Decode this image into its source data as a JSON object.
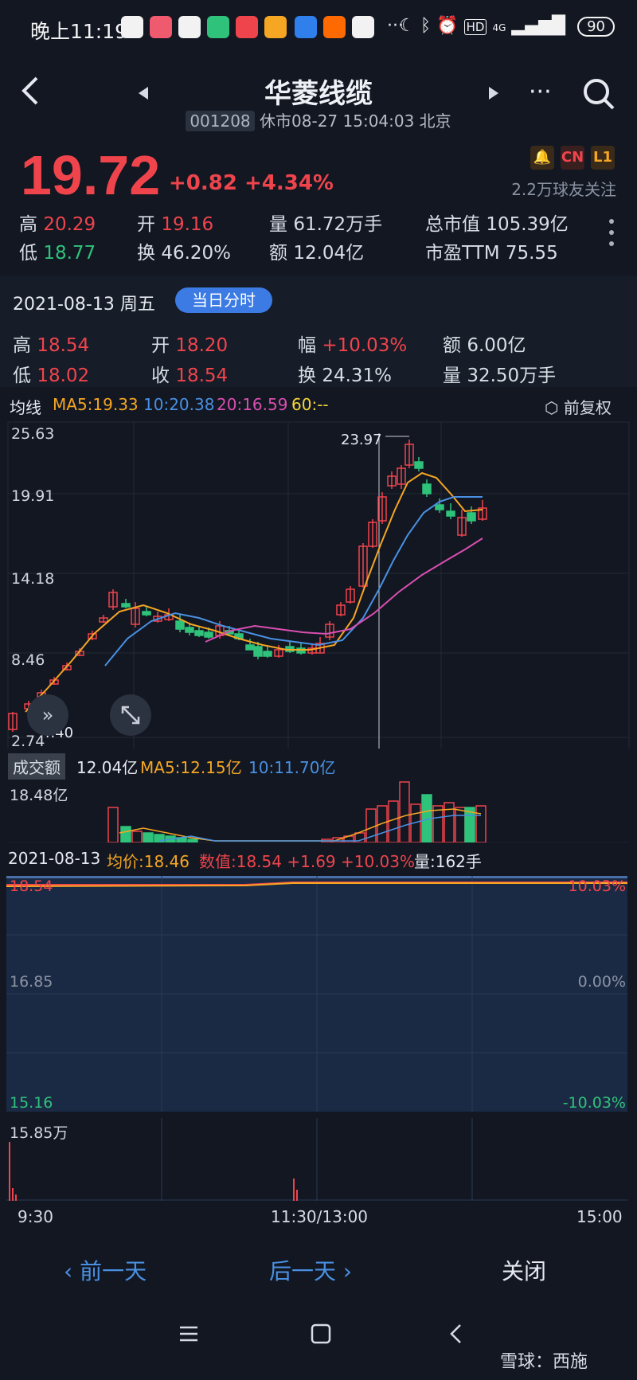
{
  "status_bar": {
    "time": "晚上11:19",
    "network": "4G",
    "hd": "HD",
    "battery": "90",
    "dots": "···"
  },
  "header": {
    "title": "华菱线缆",
    "code": "001208",
    "status": "休市08-27 15:04:03 北京",
    "more": "···"
  },
  "quote": {
    "price": "19.72",
    "change": "+0.82 +4.34%",
    "badge_cn": "CN",
    "badge_l1": "L1",
    "followers": "2.2万球友关注",
    "high_label": "高",
    "high": "20.29",
    "open_label": "开",
    "open": "19.16",
    "volume_label": "量",
    "volume": "61.72万手",
    "mktcap_label": "总市值",
    "mktcap": "105.39亿",
    "low_label": "低",
    "low": "18.77",
    "turnover_label": "换",
    "turnover": "46.20%",
    "amount_label": "额",
    "amount": "12.04亿",
    "pe_label": "市盈TTM",
    "pe": "75.55"
  },
  "day_detail": {
    "date": "2021-08-13 周五",
    "button": "当日分时",
    "high_label": "高",
    "high": "18.54",
    "open_label": "开",
    "open": "18.20",
    "range_label": "幅",
    "range": "+10.03%",
    "amount_label": "额",
    "amount": "6.00亿",
    "low_label": "低",
    "low": "18.02",
    "close_label": "收",
    "close": "18.54",
    "turnover_label": "换",
    "turnover": "24.31%",
    "volume_label": "量",
    "volume": "32.50万手"
  },
  "kline": {
    "ma_title": "均线",
    "ma5": "MA5:19.33",
    "ma10": "10:20.38",
    "ma20": "20:16.59",
    "ma60": "60:--",
    "adjust": "前复权",
    "y_labels": [
      "25.63",
      "19.91",
      "14.18",
      "8.46",
      "2.74"
    ],
    "max_label": "23.97",
    "min_label": "4.40",
    "colors": {
      "ma5": "#f5a623",
      "ma10": "#4a90e2",
      "ma20": "#d94fb0",
      "up": "#f0444c",
      "down": "#2fc27a"
    }
  },
  "volume_panel": {
    "title": "成交额",
    "amount": "12.04亿",
    "ma5": "MA5:12.15亿",
    "ma10": "10:11.70亿",
    "y_top": "18.48亿"
  },
  "intraday": {
    "date": "2021-08-13",
    "avg": "均价:18.46",
    "value": "数值:18.54 +1.69 +10.03%",
    "qty": "量:162手",
    "y_top": "18.54",
    "y_mid": "16.85",
    "y_bot": "15.16",
    "pct_top": "10.03%",
    "pct_mid": "0.00%",
    "pct_bot": "-10.03%",
    "vol_top": "15.85万",
    "t_start": "9:30",
    "t_mid": "11:30/13:00",
    "t_end": "15:00"
  },
  "footer": {
    "prev": "前一天",
    "next": "后一天",
    "close": "关闭"
  },
  "watermark": "雪球：西施"
}
